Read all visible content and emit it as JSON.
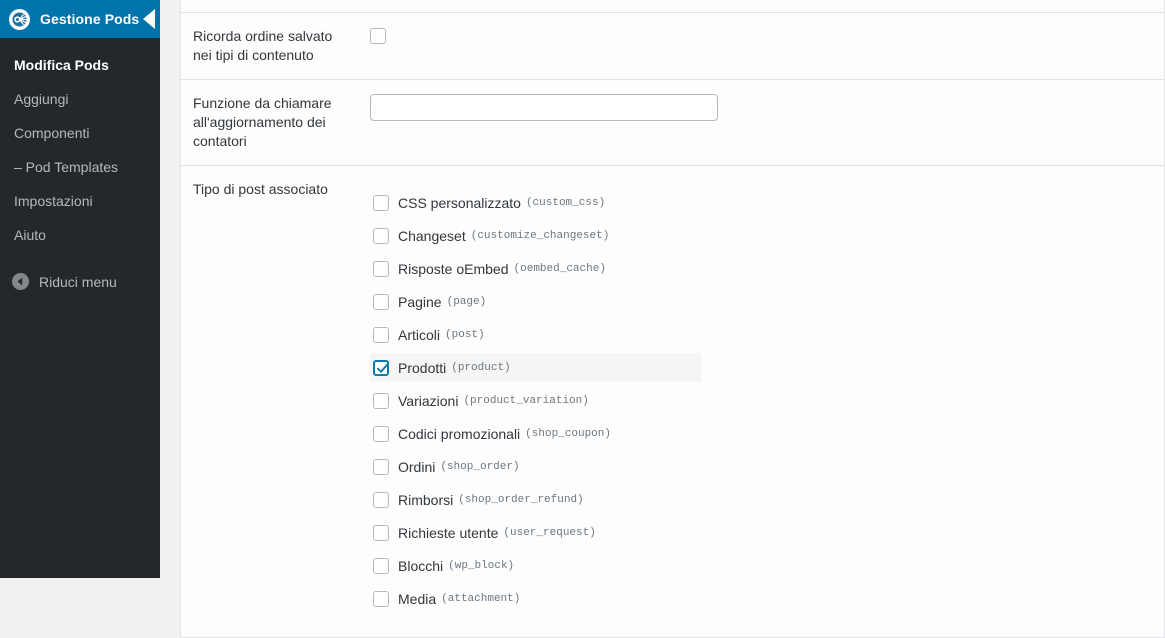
{
  "sidebar": {
    "logo_icon": "pods-logo-icon",
    "title": "Gestione Pods",
    "collapse_notch_icon": "chevron-left-icon",
    "items": [
      {
        "label": "Modifica Pods",
        "active": true
      },
      {
        "label": "Aggiungi",
        "active": false
      },
      {
        "label": "Componenti",
        "active": false
      },
      {
        "label": "– Pod Templates",
        "active": false
      },
      {
        "label": "Impostazioni",
        "active": false
      },
      {
        "label": "Aiuto",
        "active": false
      }
    ],
    "collapse": {
      "icon": "arrow-left-circle-icon",
      "label": "Riduci menu"
    },
    "colors": {
      "background": "#23282d",
      "header": "#0073aa",
      "text": "#b4b9be",
      "active_text": "#ffffff"
    }
  },
  "form": {
    "rows": [
      {
        "label": "Ricorda ordine salvato nei tipi di contenuto",
        "type": "checkbox",
        "checked": false
      },
      {
        "label": "Funzione da chiamare all'aggiornamento dei contatori",
        "type": "text",
        "value": "",
        "placeholder": ""
      },
      {
        "label": "Tipo di post associato",
        "type": "checkbox-list"
      }
    ]
  },
  "post_types": [
    {
      "label": "CSS personalizzato",
      "slug": "(custom_css)",
      "checked": false
    },
    {
      "label": "Changeset",
      "slug": "(customize_changeset)",
      "checked": false
    },
    {
      "label": "Risposte oEmbed",
      "slug": "(oembed_cache)",
      "checked": false
    },
    {
      "label": "Pagine",
      "slug": "(page)",
      "checked": false
    },
    {
      "label": "Articoli",
      "slug": "(post)",
      "checked": false
    },
    {
      "label": "Prodotti",
      "slug": "(product)",
      "checked": true
    },
    {
      "label": "Variazioni",
      "slug": "(product_variation)",
      "checked": false
    },
    {
      "label": "Codici promozionali",
      "slug": "(shop_coupon)",
      "checked": false
    },
    {
      "label": "Ordini",
      "slug": "(shop_order)",
      "checked": false
    },
    {
      "label": "Rimborsi",
      "slug": "(shop_order_refund)",
      "checked": false
    },
    {
      "label": "Richieste utente",
      "slug": "(user_request)",
      "checked": false
    },
    {
      "label": "Blocchi",
      "slug": "(wp_block)",
      "checked": false
    },
    {
      "label": "Media",
      "slug": "(attachment)",
      "checked": false
    }
  ],
  "colors": {
    "accent": "#0073aa",
    "checkbox_checked": "#0f7ca3",
    "row_highlight": "#f5f5f5",
    "panel_background": "#fdfdfd",
    "page_background": "#f1f1f1"
  }
}
